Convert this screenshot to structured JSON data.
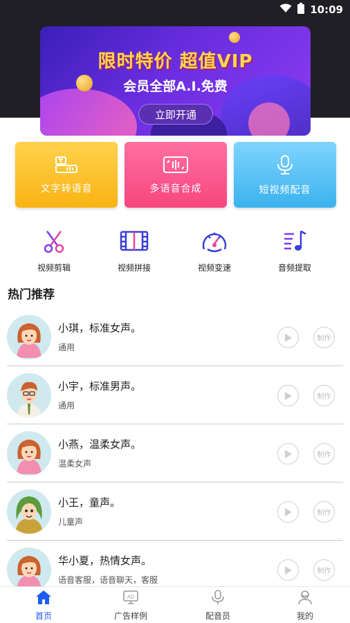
{
  "status_bar": {
    "time": "10:09"
  },
  "banner": {
    "title": "限时特价 超值VIP",
    "subtitle": "会员全部A.I.免费",
    "button_label": "立即开通"
  },
  "features": [
    {
      "label": "文字转语音",
      "icon": "text-to-speech-icon"
    },
    {
      "label": "多语音合成",
      "icon": "voice-synthesis-icon"
    },
    {
      "label": "短视频配音",
      "icon": "microphone-icon"
    }
  ],
  "tools": [
    {
      "label": "视频剪辑",
      "icon": "scissors-icon"
    },
    {
      "label": "视频拼接",
      "icon": "film-strip-icon"
    },
    {
      "label": "视频变速",
      "icon": "speedometer-icon"
    },
    {
      "label": "音频提取",
      "icon": "music-note-icon"
    }
  ],
  "section_title": "热门推荐",
  "voices": [
    {
      "name": "小琪，标准女声。",
      "tag": "通用",
      "avatar": "female"
    },
    {
      "name": "小宇，标准男声。",
      "tag": "通用",
      "avatar": "male"
    },
    {
      "name": "小燕，温柔女声。",
      "tag": "温柔女声",
      "avatar": "female"
    },
    {
      "name": "小王，童声。",
      "tag": "儿童声",
      "avatar": "child"
    },
    {
      "name": "华小夏，热情女声。",
      "tag": "语音客服，语音聊天，客服",
      "avatar": "female"
    }
  ],
  "make_label": "制作",
  "tabs": [
    {
      "label": "首页",
      "icon": "home-icon",
      "active": true
    },
    {
      "label": "广告样例",
      "icon": "ad-icon",
      "active": false
    },
    {
      "label": "配音员",
      "icon": "microphone-icon",
      "active": false
    },
    {
      "label": "我的",
      "icon": "user-icon",
      "active": false
    }
  ],
  "colors": {
    "accent": "#1f5cf2",
    "header_bg": "#1f1f25"
  }
}
